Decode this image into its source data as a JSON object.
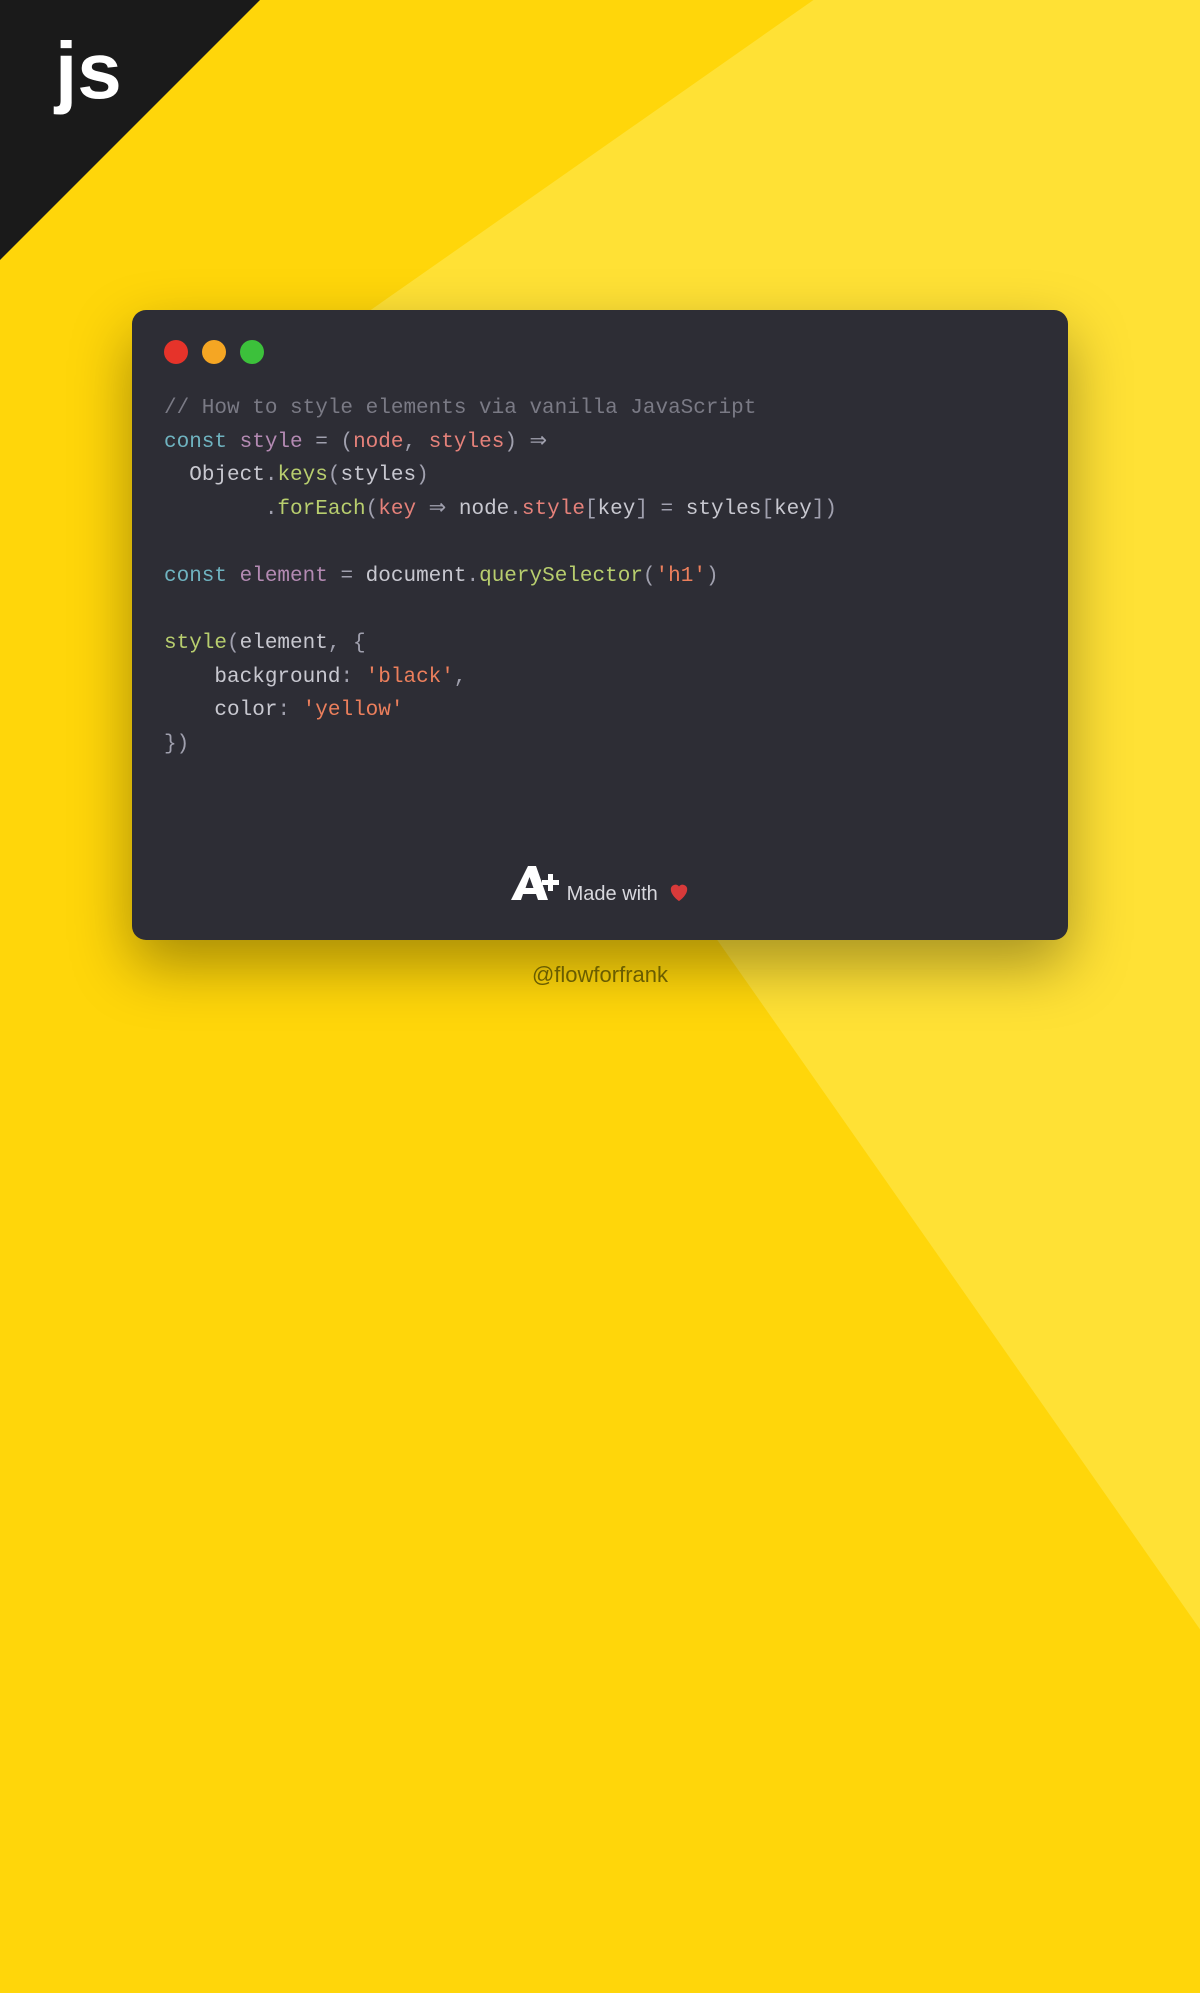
{
  "corner": {
    "label": "js"
  },
  "code": {
    "comment": "// How to style elements via vanilla JavaScript",
    "line2": {
      "const": "const",
      "style": "style",
      "eq": " = (",
      "node": "node",
      "comma": ", ",
      "styles": "styles",
      "close": ") ⇒"
    },
    "line3": {
      "indent": "  ",
      "object": "Object",
      "dot": ".",
      "keys": "keys",
      "open": "(",
      "styles": "styles",
      "close": ")"
    },
    "line4": {
      "indent": "        .",
      "forEach": "forEach",
      "open": "(",
      "key": "key",
      "arrow": " ⇒ ",
      "node": "node",
      "dot1": ".",
      "style": "style",
      "br1": "[",
      "key2": "key",
      "br2": "] = ",
      "styles": "styles",
      "br3": "[",
      "key3": "key",
      "br4": "])"
    },
    "line6": {
      "const": "const",
      "element": "element",
      "eq": " = ",
      "document": "document",
      "dot": ".",
      "querySelector": "querySelector",
      "open": "(",
      "h1": "'h1'",
      "close": ")"
    },
    "line8": {
      "style": "style",
      "open": "(",
      "element": "element",
      "comma": ", {",
      "close": ""
    },
    "line9": {
      "indent": "    ",
      "background": "background",
      "colon": ": ",
      "black": "'black'",
      "comma": ","
    },
    "line10": {
      "indent": "    ",
      "color": "color",
      "colon": ": ",
      "yellow": "'yellow'"
    },
    "line11": {
      "close": "})"
    }
  },
  "footer": {
    "made_with": "Made with",
    "heart": "♥"
  },
  "handle": "@flowforfrank"
}
